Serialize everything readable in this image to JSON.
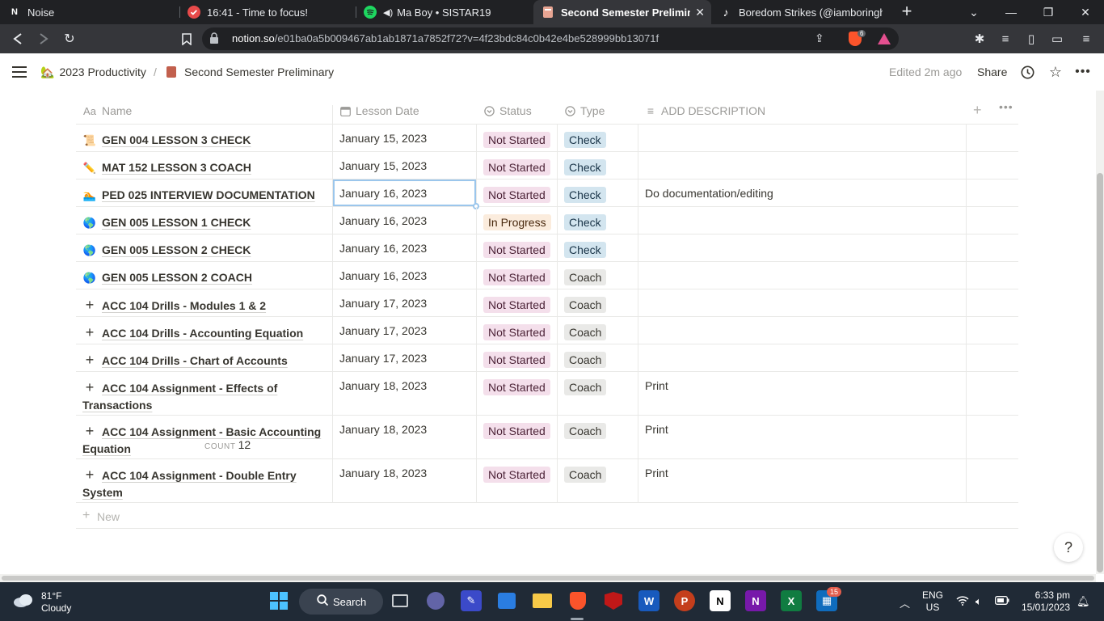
{
  "browser": {
    "tabs": [
      {
        "title": "Noise",
        "favicon": "notion-icon",
        "active": false
      },
      {
        "title": "16:41 - Time to focus!",
        "favicon": "check-circle-icon",
        "active": false
      },
      {
        "title": "Ma Boy • SISTAR19",
        "favicon": "spotify-icon",
        "active": false
      },
      {
        "title": "Second Semester Preliminary",
        "favicon": "notebook-icon",
        "active": true
      },
      {
        "title": "Boredom Strikes (@iamboringhah",
        "favicon": "tiktok-icon",
        "active": false
      }
    ],
    "url_domain": "notion.so",
    "url_path": "/e01ba0a5b009467ab1ab1871a7852f72?v=4f23bdc84c0b42e4be528999bb13071f",
    "shield_count": "6"
  },
  "notion": {
    "breadcrumb": [
      {
        "label": "2023 Productivity",
        "icon": "house-icon"
      },
      {
        "label": "Second Semester Preliminary",
        "icon": "notebook-icon"
      }
    ],
    "edited": "Edited 2m ago",
    "share": "Share"
  },
  "table": {
    "columns": [
      {
        "label": "Name",
        "icon": "Aa"
      },
      {
        "label": "Lesson Date",
        "icon": "calendar-icon"
      },
      {
        "label": "Status",
        "icon": "status-icon"
      },
      {
        "label": "Type",
        "icon": "select-icon"
      },
      {
        "label": "ADD DESCRIPTION",
        "icon": "text-lines-icon"
      }
    ],
    "rows": [
      {
        "emoji": "📜",
        "name": "GEN 004 LESSON 3 CHECK",
        "date": "January 15, 2023",
        "status": "Not Started",
        "type": "Check",
        "desc": ""
      },
      {
        "emoji": "✏️",
        "name": "MAT 152 LESSON 3 COACH",
        "date": "January 15, 2023",
        "status": "Not Started",
        "type": "Check",
        "desc": ""
      },
      {
        "emoji": "🏊",
        "name": "PED 025 INTERVIEW DOCUMENTATION",
        "date": "January 16, 2023",
        "status": "Not Started",
        "type": "Check",
        "desc": "Do documentation/editing"
      },
      {
        "emoji": "🌎",
        "name": "GEN 005 LESSON 1 CHECK",
        "date": "January 16, 2023",
        "status": "In Progress",
        "type": "Check",
        "desc": ""
      },
      {
        "emoji": "🌎",
        "name": "GEN 005 LESSON 2 CHECK",
        "date": "January 16, 2023",
        "status": "Not Started",
        "type": "Check",
        "desc": ""
      },
      {
        "emoji": "🌎",
        "name": "GEN 005 LESSON 2 COACH",
        "date": "January 16, 2023",
        "status": "Not Started",
        "type": "Coach",
        "desc": ""
      },
      {
        "emoji": "+",
        "name": "ACC 104 Drills - Modules 1 & 2",
        "date": "January 17, 2023",
        "status": "Not Started",
        "type": "Coach",
        "desc": ""
      },
      {
        "emoji": "+",
        "name": "ACC 104 Drills - Accounting Equation",
        "date": "January 17, 2023",
        "status": "Not Started",
        "type": "Coach",
        "desc": ""
      },
      {
        "emoji": "+",
        "name": "ACC 104 Drills - Chart of Accounts",
        "date": "January 17, 2023",
        "status": "Not Started",
        "type": "Coach",
        "desc": ""
      },
      {
        "emoji": "+",
        "name": "ACC 104 Assignment - Effects of Transactions",
        "date": "January 18, 2023",
        "status": "Not Started",
        "type": "Coach",
        "desc": "Print"
      },
      {
        "emoji": "+",
        "name": "ACC 104 Assignment - Basic Accounting Equation",
        "date": "January 18, 2023",
        "status": "Not Started",
        "type": "Coach",
        "desc": "Print"
      },
      {
        "emoji": "+",
        "name": "ACC 104 Assignment - Double Entry System",
        "date": "January 18, 2023",
        "status": "Not Started",
        "type": "Coach",
        "desc": "Print"
      }
    ],
    "new_label": "New",
    "count_label": "COUNT",
    "count_value": "12"
  },
  "help_label": "?",
  "taskbar": {
    "temp": "81°F",
    "condition": "Cloudy",
    "search_label": "Search",
    "notification_count": "15",
    "lang1": "ENG",
    "lang2": "US",
    "time": "6:33 pm",
    "date": "15/01/2023"
  }
}
